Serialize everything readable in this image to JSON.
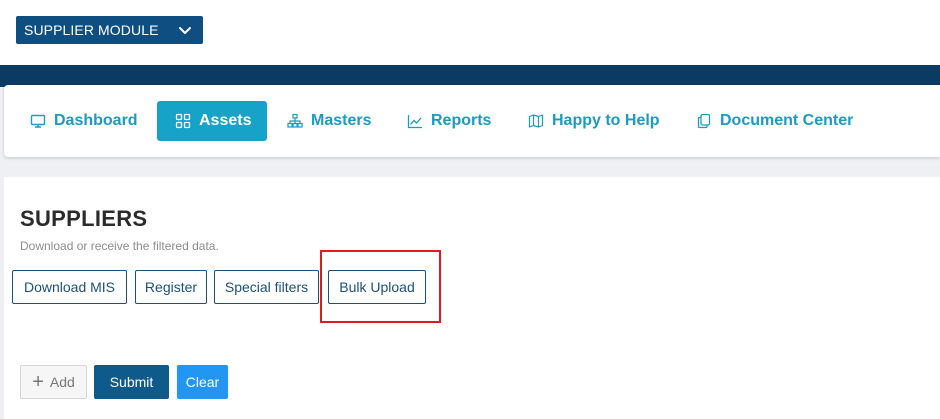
{
  "module_selector": {
    "label": "SUPPLIER MODULE",
    "icon": "chevron-down-icon"
  },
  "nav": {
    "items": [
      {
        "label": "Dashboard",
        "icon": "monitor-icon",
        "active": false
      },
      {
        "label": "Assets",
        "icon": "grid-icon",
        "active": true
      },
      {
        "label": "Masters",
        "icon": "sitemap-icon",
        "active": false
      },
      {
        "label": "Reports",
        "icon": "line-chart-icon",
        "active": false
      },
      {
        "label": "Happy to Help",
        "icon": "map-icon",
        "active": false
      },
      {
        "label": "Document Center",
        "icon": "documents-icon",
        "active": false
      }
    ]
  },
  "page": {
    "title": "SUPPLIERS",
    "subtitle": "Download or receive the filtered data."
  },
  "actions": {
    "download_mis": "Download MIS",
    "register": "Register",
    "special_filters": "Special filters",
    "bulk_upload": "Bulk Upload"
  },
  "form_buttons": {
    "add": "Add",
    "submit": "Submit",
    "clear": "Clear"
  },
  "colors": {
    "header_band": "#0b3a63",
    "nav_text": "#1a9bbf",
    "nav_active_bg": "#17a2c8",
    "submit": "#0e5a8a",
    "clear": "#2196f3",
    "highlight": "#e01b24"
  }
}
